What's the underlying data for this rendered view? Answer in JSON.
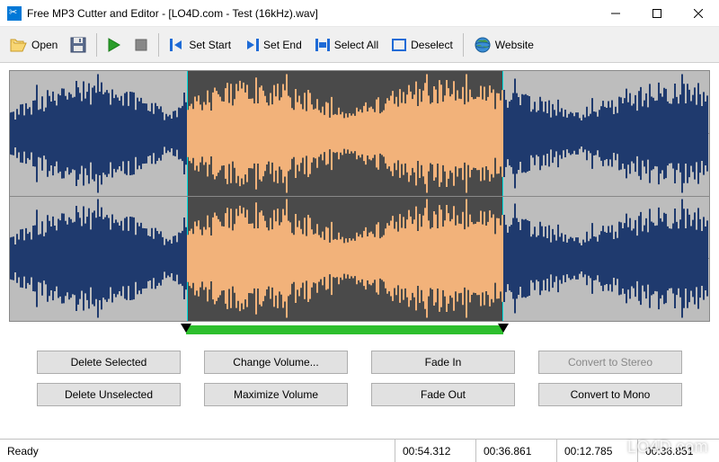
{
  "window": {
    "title": "Free MP3 Cutter and Editor - [LO4D.com - Test (16kHz).wav]"
  },
  "toolbar": {
    "open": "Open",
    "set_start": "Set Start",
    "set_end": "Set End",
    "select_all": "Select All",
    "deselect": "Deselect",
    "website": "Website"
  },
  "selection": {
    "start_pct": 25.3,
    "end_pct": 70.5
  },
  "actions": {
    "delete_selected": "Delete Selected",
    "change_volume": "Change Volume...",
    "fade_in": "Fade In",
    "convert_stereo": "Convert to Stereo",
    "delete_unselected": "Delete Unselected",
    "maximize_volume": "Maximize Volume",
    "fade_out": "Fade Out",
    "convert_mono": "Convert to Mono"
  },
  "status": {
    "ready": "Ready",
    "total": "00:54.312",
    "sel_end": "00:36.861",
    "sel_start": "00:12.785",
    "cursor": "00:36.851"
  },
  "watermark": "LO4D.com"
}
